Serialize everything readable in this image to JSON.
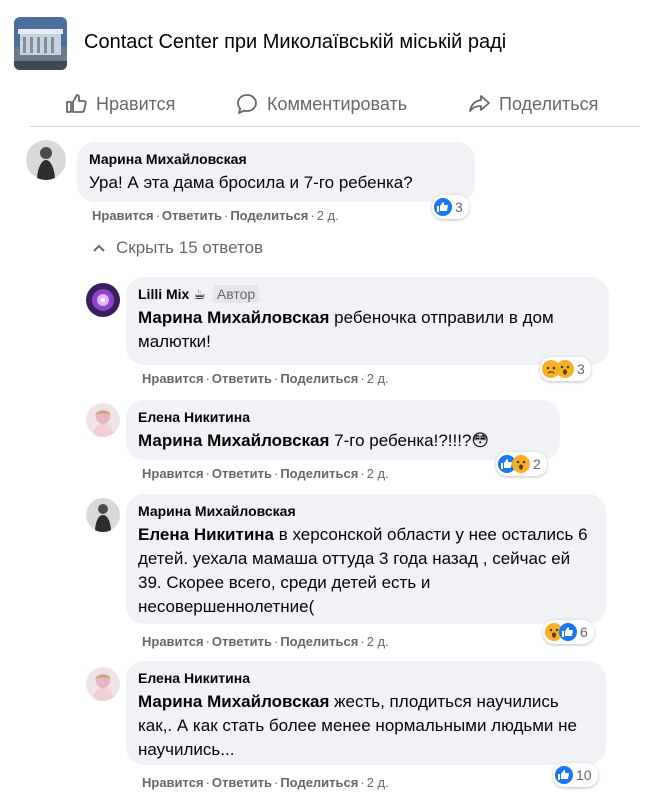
{
  "page": {
    "name": "Contact Center при Миколаївській міській раді"
  },
  "actions": {
    "like": "Нравится",
    "comment": "Комментировать",
    "share": "Поделиться"
  },
  "meta_labels": {
    "like": "Нравится",
    "reply": "Ответить",
    "share": "Поделиться",
    "dot": "·"
  },
  "top_comment": {
    "author": "Марина Михайловская",
    "text": "Ура! А эта дама бросила и 7-го ребенка?",
    "time": "2 д.",
    "reactions": {
      "icons": [
        "like-icon"
      ],
      "count": "3"
    }
  },
  "toggle_replies": {
    "label": "Скрыть 15 ответов"
  },
  "replies": [
    {
      "author": "Lilli Mix",
      "author_badge": "Автор",
      "mention": "Марина Михайловская",
      "text": "ребеночка отправили в дом малютки!",
      "time": "2 д.",
      "reactions": {
        "icons": [
          "sad-icon",
          "wow-icon"
        ],
        "count": "3"
      }
    },
    {
      "author": "Елена Никитина",
      "mention": "Марина Михайловская",
      "text": "7-го ребенка!?!!!?😳",
      "time": "2 д.",
      "reactions": {
        "icons": [
          "like-icon",
          "wow-icon"
        ],
        "count": "2"
      }
    },
    {
      "author": "Марина Михайловская",
      "mention": "Елена Никитина",
      "text": "в херсонской области у нее остались 6 детей. уехала мамаша оттуда 3 года назад , сейчас ей 39. Скорее всего, среди детей есть и несовершеннолетние(",
      "time": "2 д.",
      "reactions": {
        "icons": [
          "wow-icon",
          "like-icon"
        ],
        "count": "6"
      }
    },
    {
      "author": "Елена Никитина",
      "mention": "Марина Михайловская",
      "text": "жесть, плодиться научились как,. А как стать более менее нормальными людьми не научились...",
      "time": "2 д.",
      "reactions": {
        "icons": [
          "like-icon"
        ],
        "count": "10"
      }
    }
  ],
  "colors": {
    "like": "#1877f2",
    "wow": "#f7b125",
    "bubble": "#f0f2f5",
    "muted": "#65676b"
  }
}
